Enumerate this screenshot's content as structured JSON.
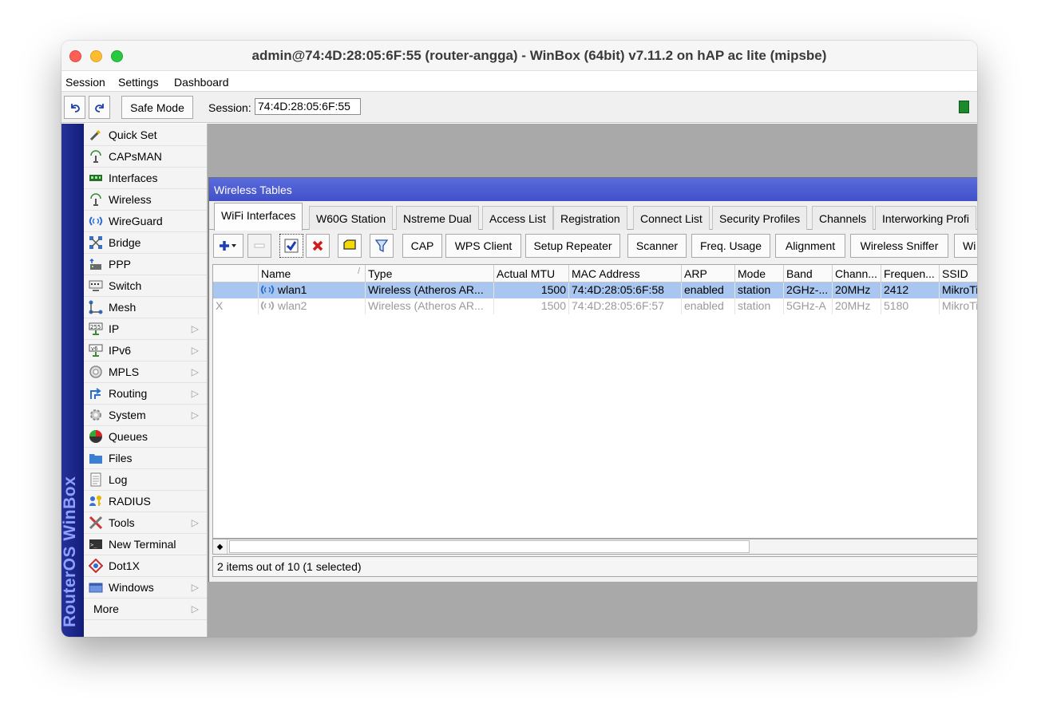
{
  "window": {
    "title": "admin@74:4D:28:05:6F:55 (router-angga) - WinBox (64bit) v7.11.2 on hAP ac lite (mipsbe)"
  },
  "menubar": {
    "items": [
      "Session",
      "Settings",
      "Dashboard"
    ]
  },
  "toolbar": {
    "undo_icon": "undo-icon",
    "redo_icon": "redo-icon",
    "safe_mode_label": "Safe Mode",
    "session_label": "Session:",
    "session_value": "74:4D:28:05:6F:55"
  },
  "brand": {
    "vertical_text": "RouterOS WinBox"
  },
  "sidebar": {
    "items": [
      {
        "label": "Quick Set",
        "icon": "wand-icon"
      },
      {
        "label": "CAPsMAN",
        "icon": "antenna-icon"
      },
      {
        "label": "Interfaces",
        "icon": "interfaces-icon"
      },
      {
        "label": "Wireless",
        "icon": "antenna-icon"
      },
      {
        "label": "WireGuard",
        "icon": "wireguard-icon"
      },
      {
        "label": "Bridge",
        "icon": "bridge-icon"
      },
      {
        "label": "PPP",
        "icon": "ppp-icon"
      },
      {
        "label": "Switch",
        "icon": "switch-icon"
      },
      {
        "label": "Mesh",
        "icon": "mesh-icon"
      },
      {
        "label": "IP",
        "icon": "ip-icon",
        "submenu": true
      },
      {
        "label": "IPv6",
        "icon": "ipv6-icon",
        "submenu": true
      },
      {
        "label": "MPLS",
        "icon": "mpls-icon",
        "submenu": true
      },
      {
        "label": "Routing",
        "icon": "routing-icon",
        "submenu": true
      },
      {
        "label": "System",
        "icon": "gear-icon",
        "submenu": true
      },
      {
        "label": "Queues",
        "icon": "queues-icon"
      },
      {
        "label": "Files",
        "icon": "folder-icon"
      },
      {
        "label": "Log",
        "icon": "log-icon"
      },
      {
        "label": "RADIUS",
        "icon": "radius-icon"
      },
      {
        "label": "Tools",
        "icon": "tools-icon",
        "submenu": true
      },
      {
        "label": "New Terminal",
        "icon": "terminal-icon"
      },
      {
        "label": "Dot1X",
        "icon": "dot1x-icon"
      },
      {
        "label": "Windows",
        "icon": "windows-icon",
        "submenu": true
      },
      {
        "label": "More",
        "icon": "",
        "submenu": true
      }
    ]
  },
  "wireless_window": {
    "title": "Wireless Tables",
    "tabs": [
      "WiFi Interfaces",
      "W60G Station",
      "Nstreme Dual",
      "Access List",
      "Registration",
      "Connect List",
      "Security Profiles",
      "Channels",
      "Interworking Profi"
    ],
    "active_tab": 0,
    "actions": {
      "add_icon": "plus-icon",
      "remove_icon": "minus-icon",
      "enable_icon": "check-icon",
      "disable_icon": "x-icon",
      "comment_icon": "comment-icon",
      "filter_icon": "filter-icon",
      "buttons": [
        "CAP",
        "WPS Client",
        "Setup Repeater",
        "Scanner",
        "Freq. Usage",
        "Alignment",
        "Wireless Sniffer",
        "Wi"
      ]
    },
    "table": {
      "columns": [
        "Name",
        "Type",
        "Actual MTU",
        "MAC Address",
        "ARP",
        "Mode",
        "Band",
        "Chann...",
        "Frequen...",
        "SSID"
      ],
      "rows": [
        {
          "flag": "",
          "name": "wlan1",
          "type": "Wireless (Atheros AR...",
          "mtu": "1500",
          "mac": "74:4D:28:05:6F:58",
          "arp": "enabled",
          "mode": "station",
          "band": "2GHz-...",
          "channel": "20MHz",
          "freq": "2412",
          "ssid": "MikroTik",
          "selected": true,
          "disabled": false
        },
        {
          "flag": "X",
          "name": "wlan2",
          "type": "Wireless (Atheros AR...",
          "mtu": "1500",
          "mac": "74:4D:28:05:6F:57",
          "arp": "enabled",
          "mode": "station",
          "band": "5GHz-A",
          "channel": "20MHz",
          "freq": "5180",
          "ssid": "MikroTik",
          "selected": false,
          "disabled": true
        }
      ]
    },
    "status": "2 items out of 10 (1 selected)"
  }
}
